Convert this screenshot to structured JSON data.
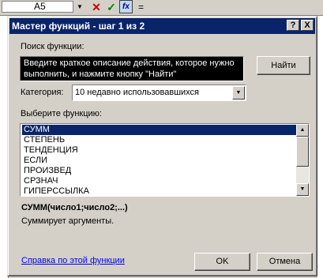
{
  "formula_bar": {
    "cell_reference": "A5",
    "name_box_arrow_icon": "dropdown-arrow",
    "cancel_icon": "✕",
    "enter_icon": "✓",
    "fx_label": "fx",
    "formula_text": "="
  },
  "dialog": {
    "title": "Мастер функций - шаг 1 из 2",
    "help_button_label": "?",
    "close_button_label": "X",
    "search": {
      "label": "Поиск функции:",
      "value": "Введите краткое описание действия, которое нужно выполнить, и нажмите кнопку \"Найти\"",
      "find_button_label": "Найти"
    },
    "category": {
      "label": "Категория:",
      "selected": "10 недавно использовавшихся"
    },
    "function_list": {
      "label": "Выберите функцию:",
      "items": [
        "СУММ",
        "СТЕПЕНЬ",
        "ТЕНДЕНЦИЯ",
        "ЕСЛИ",
        "ПРОИЗВЕД",
        "СРЗНАЧ",
        "ГИПЕРССЫЛКА"
      ],
      "selected_index": 0
    },
    "selected_function": {
      "syntax": "СУММ(число1;число2;...)",
      "description": "Суммирует аргументы."
    },
    "help_link": "Справка по этой функции",
    "ok_label": "OK",
    "cancel_label": "Отмена"
  },
  "colors": {
    "titlebar": "#0a246a",
    "selection": "#0a246a",
    "dialog_face": "#d4d0c8",
    "link": "#0000ff"
  }
}
